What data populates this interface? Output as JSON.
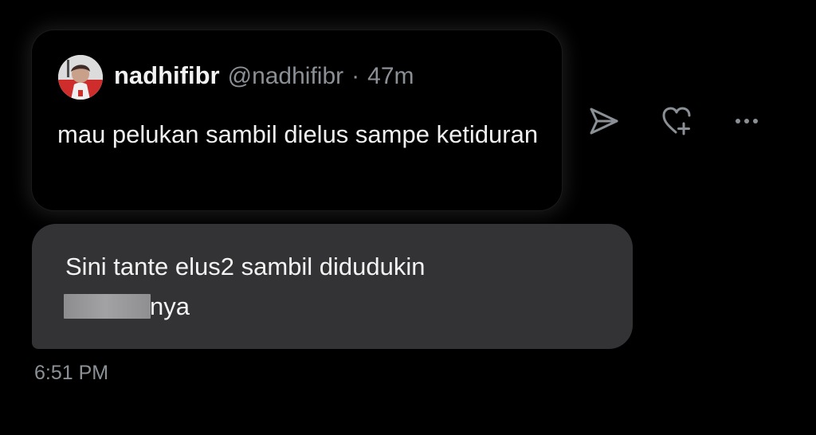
{
  "quoted_post": {
    "author_name": "nadhifibr",
    "author_handle": "@nadhifibr",
    "separator": "·",
    "time_ago": "47m",
    "text": "mau pelukan sambil dielus sampe ketiduran"
  },
  "actions": {
    "share_icon": "send-icon",
    "react_icon": "heart-plus-icon",
    "more_icon": "more-icon"
  },
  "message": {
    "text_line1": "Sini tante elus2 sambil didudukin",
    "text_tail": "nya",
    "timestamp": "6:51 PM"
  },
  "colors": {
    "background": "#000000",
    "bubble": "#333336",
    "muted_text": "#8b9096",
    "primary_text": "#f0f0f0"
  }
}
